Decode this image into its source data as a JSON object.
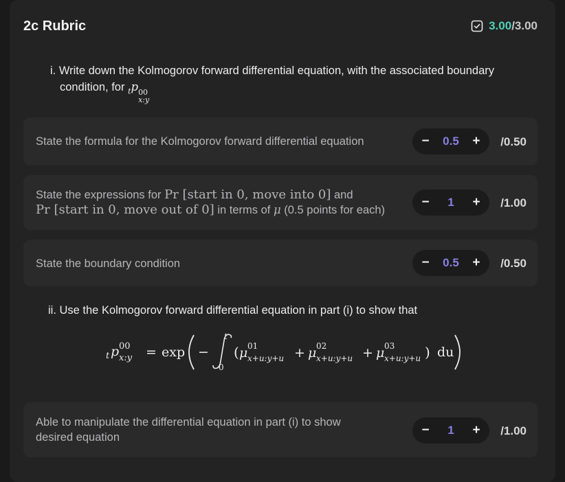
{
  "header": {
    "title": "2c Rubric",
    "score_got": "3.00",
    "score_total": "/3.00"
  },
  "question_i": {
    "line1": "i. Write down the Kolmogorov forward differential equation, with the associated boundary",
    "line2_prefix": "condition, for",
    "symbol": "tp00x:y"
  },
  "criteria": [
    {
      "text": "State the formula for the Kolmogorov forward differential equation",
      "value": "0.5",
      "max": "/0.50"
    },
    {
      "line1_prefix": "State the expressions for",
      "line1_math": "Pr [start in 0, move into 0]",
      "line1_suffix": "and",
      "line2_math": "Pr [start in 0, move out of 0]",
      "line2_mid": "in terms of",
      "line2_mu": "μ",
      "line2_suffix": "(0.5 points for each)",
      "value": "1",
      "max": "/1.00"
    },
    {
      "text": "State the boundary condition",
      "value": "0.5",
      "max": "/0.50"
    },
    {
      "text": "Able to manipulate the differential equation in part (i) to show desired equation",
      "line1": "Able to manipulate the differential equation in part (i) to show",
      "line2": "desired equation",
      "value": "1",
      "max": "/1.00"
    }
  ],
  "question_ii": {
    "text": "ii. Use the Kolmogorov forward differential equation in part (i) to show that"
  },
  "formula": {
    "lhs_p": "p",
    "lhs_t": "t",
    "lhs_sup": "00",
    "lhs_sub": "x:y",
    "eq": "=",
    "exp": "exp",
    "int_upper": "t",
    "int_lower": "0",
    "mu": "μ",
    "sup1": "01",
    "sup2": "02",
    "sup3": "03",
    "sub": "x+u:y+u",
    "plus": "+",
    "minus": "−",
    "du": "du"
  },
  "stepper_minus": "−",
  "stepper_plus": "+",
  "icons": {
    "score": "checkbox-icon"
  }
}
